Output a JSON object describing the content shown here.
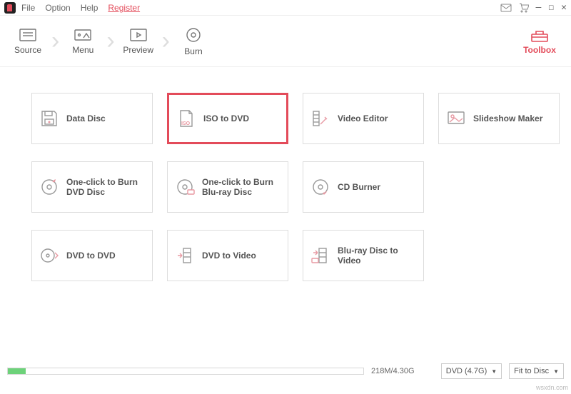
{
  "menu": {
    "file": "File",
    "option": "Option",
    "help": "Help",
    "register": "Register"
  },
  "nav": {
    "source": "Source",
    "menu": "Menu",
    "preview": "Preview",
    "burn": "Burn",
    "toolbox": "Toolbox"
  },
  "cards": {
    "data_disc": "Data Disc",
    "iso_to_dvd": "ISO to DVD",
    "video_editor": "Video Editor",
    "slideshow_maker": "Slideshow Maker",
    "one_click_dvd": "One-click to Burn DVD Disc",
    "one_click_bluray": "One-click to Burn Blu-ray Disc",
    "cd_burner": "CD Burner",
    "dvd_to_dvd": "DVD to DVD",
    "dvd_to_video": "DVD to Video",
    "bluray_to_video": "Blu-ray Disc to Video"
  },
  "footer": {
    "size_label": "218M/4.30G",
    "disc_type": "DVD (4.7G)",
    "fit": "Fit to Disc",
    "fill_percent": 5
  },
  "watermark": "wsxdn.com"
}
